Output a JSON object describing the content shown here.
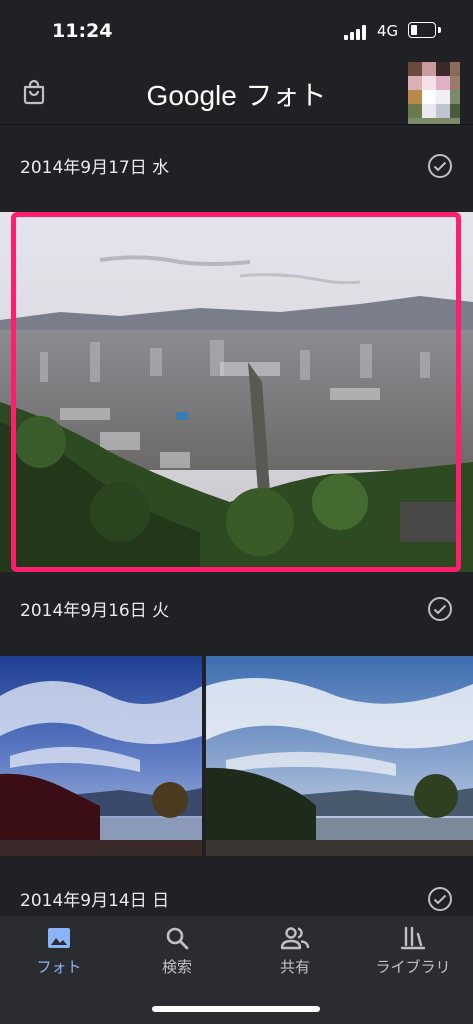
{
  "status": {
    "time": "11:24",
    "network": "4G",
    "battery_level": 0.3
  },
  "header": {
    "brand": "Google",
    "title_suffix": " フォト"
  },
  "sections": [
    {
      "date": "2014年9月17日 水"
    },
    {
      "date": "2014年9月16日 火"
    },
    {
      "date": "2014年9月14日 日"
    }
  ],
  "nav": {
    "items": [
      {
        "label": "フォト",
        "icon": "photo-icon",
        "active": true
      },
      {
        "label": "検索",
        "icon": "search-icon",
        "active": false
      },
      {
        "label": "共有",
        "icon": "people-icon",
        "active": false
      },
      {
        "label": "ライブラリ",
        "icon": "library-icon",
        "active": false
      }
    ]
  },
  "colors": {
    "background": "#202124",
    "accent": "#8ab4f8",
    "highlight": "#ff1e6e"
  }
}
